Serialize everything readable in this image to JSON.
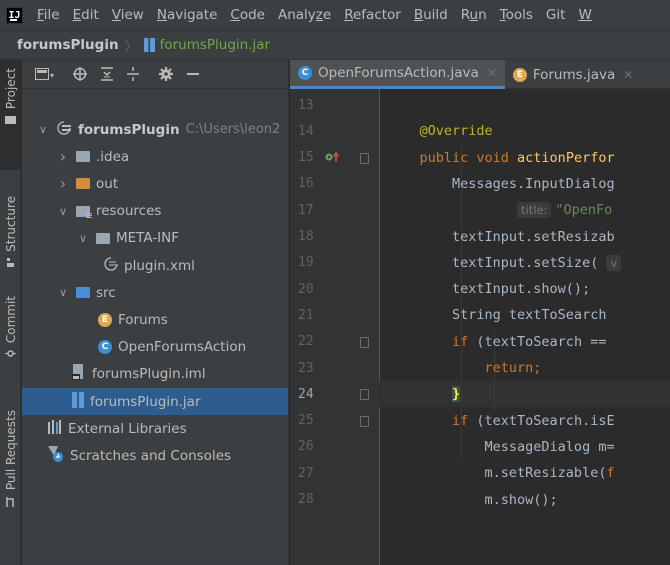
{
  "menu": {
    "logo": "IJ",
    "items": [
      "File",
      "Edit",
      "View",
      "Navigate",
      "Code",
      "Analyze",
      "Refactor",
      "Build",
      "Run",
      "Tools",
      "Git",
      "W"
    ],
    "mnemonic_index": [
      0,
      0,
      0,
      0,
      0,
      5,
      0,
      0,
      1,
      0,
      -1,
      0
    ]
  },
  "breadcrumb": {
    "project": "forumsPlugin",
    "file": "forumsPlugin.jar"
  },
  "stripe": {
    "project": "Project",
    "structure": "Structure",
    "commit": "Commit",
    "pull_requests": "Pull Requests"
  },
  "tree": [
    {
      "label": "forumsPlugin",
      "path": "C:\\Users\\leon2",
      "icon": "module-folder-icon",
      "depth": 0,
      "chevron": "expanded"
    },
    {
      "label": ".idea",
      "icon": "folder-icon",
      "depth": 1,
      "chevron": "collapsed"
    },
    {
      "label": "out",
      "icon": "excluded-folder-icon",
      "depth": 1,
      "chevron": "collapsed"
    },
    {
      "label": "resources",
      "icon": "resources-folder-icon",
      "depth": 1,
      "chevron": "expanded"
    },
    {
      "label": "META-INF",
      "icon": "folder-icon",
      "depth": 2,
      "chevron": "expanded"
    },
    {
      "label": "plugin.xml",
      "icon": "xml-file-icon",
      "depth": 3,
      "chevron": "none"
    },
    {
      "label": "src",
      "icon": "source-folder-icon",
      "depth": 1,
      "chevron": "expanded"
    },
    {
      "label": "Forums",
      "icon": "enum-icon",
      "depth": 2,
      "chevron": "none"
    },
    {
      "label": "OpenForumsAction",
      "icon": "class-icon",
      "depth": 2,
      "chevron": "none"
    },
    {
      "label": "forumsPlugin.iml",
      "icon": "iml-file-icon",
      "depth": 1,
      "chevron": "none"
    },
    {
      "label": "forumsPlugin.jar",
      "icon": "jar-file-icon",
      "depth": 1,
      "chevron": "none",
      "selected": true
    },
    {
      "label": "External Libraries",
      "icon": "libraries-icon",
      "depth": 0,
      "chevron": "none"
    },
    {
      "label": "Scratches and Consoles",
      "icon": "scratches-icon",
      "depth": 0,
      "chevron": "none"
    }
  ],
  "tabs": [
    {
      "label": "OpenForumsAction.java",
      "icon": "class-icon",
      "active": true
    },
    {
      "label": "Forums.java",
      "icon": "enum-icon",
      "active": false
    }
  ],
  "editor": {
    "current_line": 24,
    "line_numbers": [
      "13",
      "14",
      "15",
      "16",
      "17",
      "18",
      "19",
      "20",
      "21",
      "22",
      "23",
      "24",
      "25",
      "26",
      "27",
      "28"
    ],
    "lines": [
      [],
      [
        {
          "t": "    @Override",
          "c": "ann"
        }
      ],
      [
        {
          "t": "    public void ",
          "c": "kw"
        },
        {
          "t": "actionPerfor",
          "c": "fn"
        }
      ],
      [
        {
          "t": "        Messages.InputDialog",
          "c": "txt"
        }
      ],
      [
        {
          "t": "                ",
          "c": "txt"
        },
        {
          "t": "title:",
          "c": "hint"
        },
        {
          "t": "\"OpenFo",
          "c": "str"
        }
      ],
      [
        {
          "t": "        textInput.setResizab",
          "c": "txt"
        }
      ],
      [
        {
          "t": "        textInput.setSize( ",
          "c": "txt"
        },
        {
          "t": "v",
          "c": "hint"
        }
      ],
      [
        {
          "t": "        textInput.show();",
          "c": "txt"
        }
      ],
      [
        {
          "t": "        String textToSearch ",
          "c": "txt"
        }
      ],
      [
        {
          "t": "        if ",
          "c": "kw"
        },
        {
          "t": "(textToSearch == ",
          "c": "txt"
        }
      ],
      [
        {
          "t": "            return;",
          "c": "kw"
        }
      ],
      [
        {
          "t": "        ",
          "c": "txt"
        },
        {
          "t": "}",
          "c": "brace"
        }
      ],
      [
        {
          "t": "        if ",
          "c": "kw"
        },
        {
          "t": "(textToSearch.isE",
          "c": "txt"
        }
      ],
      [
        {
          "t": "            MessageDialog m=",
          "c": "txt"
        }
      ],
      [
        {
          "t": "            m.setResizable(",
          "c": "txt"
        },
        {
          "t": "f",
          "c": "kw"
        }
      ],
      [
        {
          "t": "            m.show();",
          "c": "txt"
        }
      ]
    ]
  },
  "colors": {
    "selection": "#2d5c8f",
    "accent": "#4a88c7",
    "keyword": "#cc7832",
    "annotation": "#bbb529",
    "method": "#ffc66d",
    "string": "#6a8759"
  }
}
